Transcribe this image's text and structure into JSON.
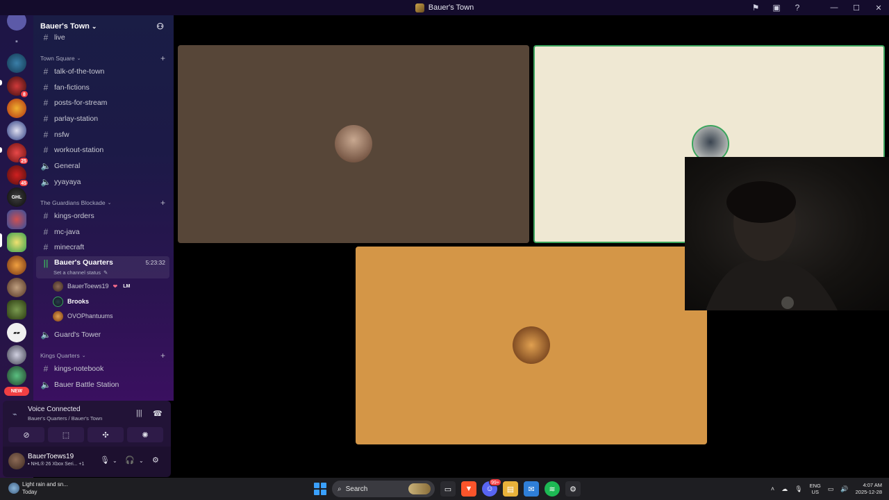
{
  "window": {
    "title": "Bauer's Town"
  },
  "rail": {
    "new_label": "NEW",
    "badges": [
      "8",
      "25",
      "45"
    ]
  },
  "guild": {
    "name": "Bauer's Town"
  },
  "channels": {
    "partial_top": "live",
    "categories": [
      {
        "name": "Town Square",
        "items": [
          {
            "type": "text",
            "name": "talk-of-the-town"
          },
          {
            "type": "text",
            "name": "fan-fictions"
          },
          {
            "type": "text",
            "name": "posts-for-stream"
          },
          {
            "type": "text",
            "name": "parlay-station"
          },
          {
            "type": "text",
            "name": "nsfw"
          },
          {
            "type": "text",
            "name": "workout-station"
          },
          {
            "type": "voice",
            "name": "General"
          },
          {
            "type": "voice",
            "name": "yyayaya"
          }
        ]
      },
      {
        "name": "The Guardians Blockade",
        "items": [
          {
            "type": "text",
            "name": "kings-orders"
          },
          {
            "type": "text",
            "name": "mc-java"
          },
          {
            "type": "text",
            "name": "minecraft"
          }
        ]
      },
      {
        "name": "Kings Quarters",
        "items": [
          {
            "type": "text",
            "name": "kings-notebook"
          },
          {
            "type": "voice",
            "name": "Bauer Battle Station"
          }
        ]
      }
    ],
    "active_voice": {
      "name": "Bauer's Quarters",
      "timer": "5:23:32",
      "status": "Set a channel status",
      "users": [
        {
          "name": "BauerToews19",
          "badge": "LM"
        },
        {
          "name": "Brooks"
        },
        {
          "name": "OVOPhantuums"
        }
      ]
    },
    "guards_tower": "Guard's Tower"
  },
  "voice_panel": {
    "title": "Voice Connected",
    "subtitle": "Bauer's Quarters / Bauer's Town"
  },
  "user_panel": {
    "username": "BauerToews19",
    "status": "NHL® 26 Xbox Seri...",
    "extra": "+1"
  },
  "taskbar": {
    "weather_line1": "Light rain and sn...",
    "weather_line2": "Today",
    "search_label": "Search",
    "lang_line1": "ENG",
    "lang_line2": "US",
    "time": "4:07 AM",
    "date": "2025-12-28",
    "discord_badge": "99+"
  },
  "colors": {
    "speaking_border": "#3ba55d",
    "tile1_bg": "#574638",
    "tile2_bg": "#efe8d3",
    "tile3_bg": "#d49647"
  }
}
